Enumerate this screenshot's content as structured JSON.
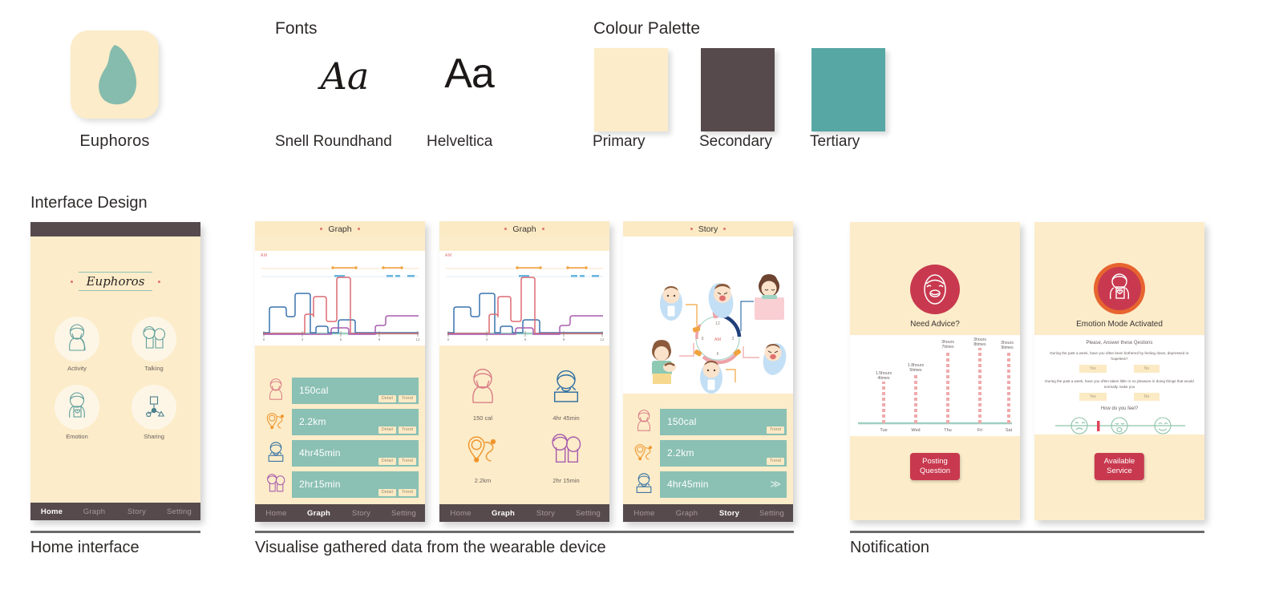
{
  "brand": {
    "app_name": "Euphoros",
    "logo_icon": "leaf-drop-icon"
  },
  "fonts": {
    "title": "Fonts",
    "sample_script": "Aa",
    "sample_sans": "Aa",
    "label_script": "Snell Roundhand",
    "label_sans": "Helveltica"
  },
  "palette": {
    "title": "Colour Palette",
    "swatches": [
      {
        "label": "Primary",
        "hex": "#fcecc9"
      },
      {
        "label": "Secondary",
        "hex": "#574a4c"
      },
      {
        "label": "Tertiary",
        "hex": "#57a7a4"
      }
    ]
  },
  "sections": {
    "interface_design": "Interface Design",
    "caption_home": "Home interface",
    "caption_graph": "Visualise gathered data from the wearable device",
    "caption_notification": "Notification"
  },
  "nav": {
    "items": [
      "Home",
      "Graph",
      "Story",
      "Setting"
    ]
  },
  "home_screen": {
    "wordmark": "Euphoros",
    "tiles": [
      {
        "label": "Activity",
        "icon": "person-activity-icon"
      },
      {
        "label": "Talking",
        "icon": "two-people-talking-icon"
      },
      {
        "label": "Emotion",
        "icon": "person-heart-note-icon"
      },
      {
        "label": "Sharing",
        "icon": "share-network-icon"
      }
    ],
    "active_nav": "Home"
  },
  "graph_screen": {
    "title": "Graph",
    "am_label": "AM",
    "active_nav": "Graph",
    "cards": [
      {
        "value": "150cal",
        "icon": "person-activity-icon",
        "buttons": [
          "Detail",
          "Trend"
        ]
      },
      {
        "value": "2.2km",
        "icon": "location-route-icon",
        "buttons": [
          "Detail",
          "Trend"
        ]
      },
      {
        "value": "4hr45min",
        "icon": "person-sleeping-icon",
        "buttons": [
          "Detail",
          "Trend"
        ]
      },
      {
        "value": "2hr15min",
        "icon": "two-people-talking-icon",
        "buttons": [
          "Detail",
          "Trend"
        ]
      }
    ]
  },
  "graph_screen_alt": {
    "title": "Graph",
    "am_label": "AM",
    "active_nav": "Graph",
    "tiles": [
      {
        "label": "150 cal",
        "icon": "person-activity-icon"
      },
      {
        "label": "4hr 45min",
        "icon": "person-sleeping-icon"
      },
      {
        "label": "2.2km",
        "icon": "location-route-icon"
      },
      {
        "label": "2hr 15min",
        "icon": "two-people-talking-icon"
      }
    ]
  },
  "story_screen": {
    "title": "Story",
    "active_nav": "Story",
    "clock": {
      "am_label": "AM",
      "ticks": [
        "12",
        "3",
        "6",
        "9"
      ]
    },
    "cards": [
      {
        "value": "150cal",
        "icon": "person-activity-icon",
        "buttons": [
          "Trend"
        ]
      },
      {
        "value": "2.2km",
        "icon": "location-route-icon",
        "buttons": [
          "Trend"
        ]
      },
      {
        "value": "4hr45min",
        "icon": "person-sleeping-icon",
        "buttons": []
      }
    ],
    "expand_icon": "chevron-double-down-icon"
  },
  "notification_advice": {
    "hero_icon": "baby-face-icon",
    "hero_title": "Need Advice?",
    "button_label": "Posting\nQuestion",
    "button_line1": "Posting",
    "button_line2": "Question"
  },
  "notification_emotion": {
    "hero_icon": "person-heart-note-icon",
    "hero_title": "Emotion Mode Activated",
    "questions_heading": "Please, Answer these Qestions",
    "question_1": "During the past a week, have you often been bothered by feeling down, depressed or hopeless?",
    "question_2": "During the past a week, have you often taken little or no pleasure in doing things that would normally make you",
    "answer_yes": "Yes",
    "answer_no": "No",
    "feel_heading": "How do you feel?",
    "feel_faces": [
      "sad-face-icon",
      "neutral-face-icon",
      "happy-face-icon"
    ],
    "button_line1": "Available",
    "button_line2": "Service"
  },
  "chart_data": [
    {
      "type": "line",
      "title": "Graph",
      "xlabel": "",
      "ylabel": "",
      "x_ticks": [
        "0",
        "3",
        "6",
        "9",
        "12"
      ],
      "xlim": [
        0,
        12
      ],
      "ylim": [
        0,
        10
      ],
      "grid": false,
      "legend": "none",
      "series": [
        {
          "name": "Activity",
          "color": "#dd6a72",
          "x": [
            0,
            3.4,
            3.4,
            4.4,
            4.4,
            5.6,
            5.6,
            6.0,
            6.0,
            7.3,
            7.3,
            12
          ],
          "y": [
            0,
            0,
            4.1,
            4.1,
            0.2,
            0.2,
            9.3,
            9.3,
            0.2,
            0.2,
            0,
            0
          ]
        },
        {
          "name": "Sleep",
          "color": "#3a73ad",
          "x": [
            0,
            0.55,
            0.55,
            2.3,
            2.3,
            2.85,
            2.85,
            4.35,
            4.35,
            5.1,
            5.1,
            6.3,
            6.3,
            7.7,
            7.7,
            9.1,
            9.1,
            12
          ],
          "y": [
            0,
            0,
            2.9,
            2.9,
            2.2,
            2.2,
            5.2,
            5.2,
            0,
            0,
            0.8,
            0.8,
            0,
            0,
            1.6,
            1.6,
            0,
            0
          ]
        },
        {
          "name": "Talking",
          "color": "#a95dad",
          "x": [
            0,
            5.6,
            5.6,
            7.1,
            7.1,
            9.2,
            9.2,
            10.2,
            10.2,
            12
          ],
          "y": [
            0,
            0,
            0.55,
            0.55,
            0,
            0,
            1.1,
            1.1,
            2.3,
            2.3
          ]
        }
      ],
      "event_bars": [
        {
          "color": "#f0a33e",
          "x0": 5.6,
          "x1": 7.4,
          "row": 1
        },
        {
          "color": "#f0a33e",
          "x0": 9.5,
          "x1": 10.9,
          "row": 1
        },
        {
          "color": "#6bb6e0",
          "x0": 5.8,
          "x1": 6.4,
          "row": 2
        },
        {
          "color": "#6bb6e0",
          "x0": 9.6,
          "x1": 10.3,
          "row": 2
        },
        {
          "color": "#6bb6e0",
          "x0": 11.0,
          "x1": 11.5,
          "row": 2
        }
      ]
    },
    {
      "type": "bar",
      "title": "",
      "xlabel": "",
      "ylabel": "",
      "categories": [
        "Tue",
        "Wed",
        "Thu",
        "Fri",
        "Sat"
      ],
      "values": [
        1.5,
        1.8,
        3.0,
        3.0,
        3.0
      ],
      "value_labels": [
        "1.5hours\n4times",
        "1.8hours\n5times",
        "3hours\n7times",
        "3hours\n8times",
        "3hours\n9times"
      ],
      "labels_line1": [
        "1.5hours",
        "1.8hours",
        "3hours",
        "3hours",
        "3hours"
      ],
      "labels_line2": [
        "4times",
        "5times",
        "7times",
        "8times",
        "9times"
      ],
      "ylim": [
        0,
        3.6
      ],
      "grid": false,
      "bar_color": "#f0a9ab",
      "axis_color": "#9ecfc2"
    }
  ]
}
